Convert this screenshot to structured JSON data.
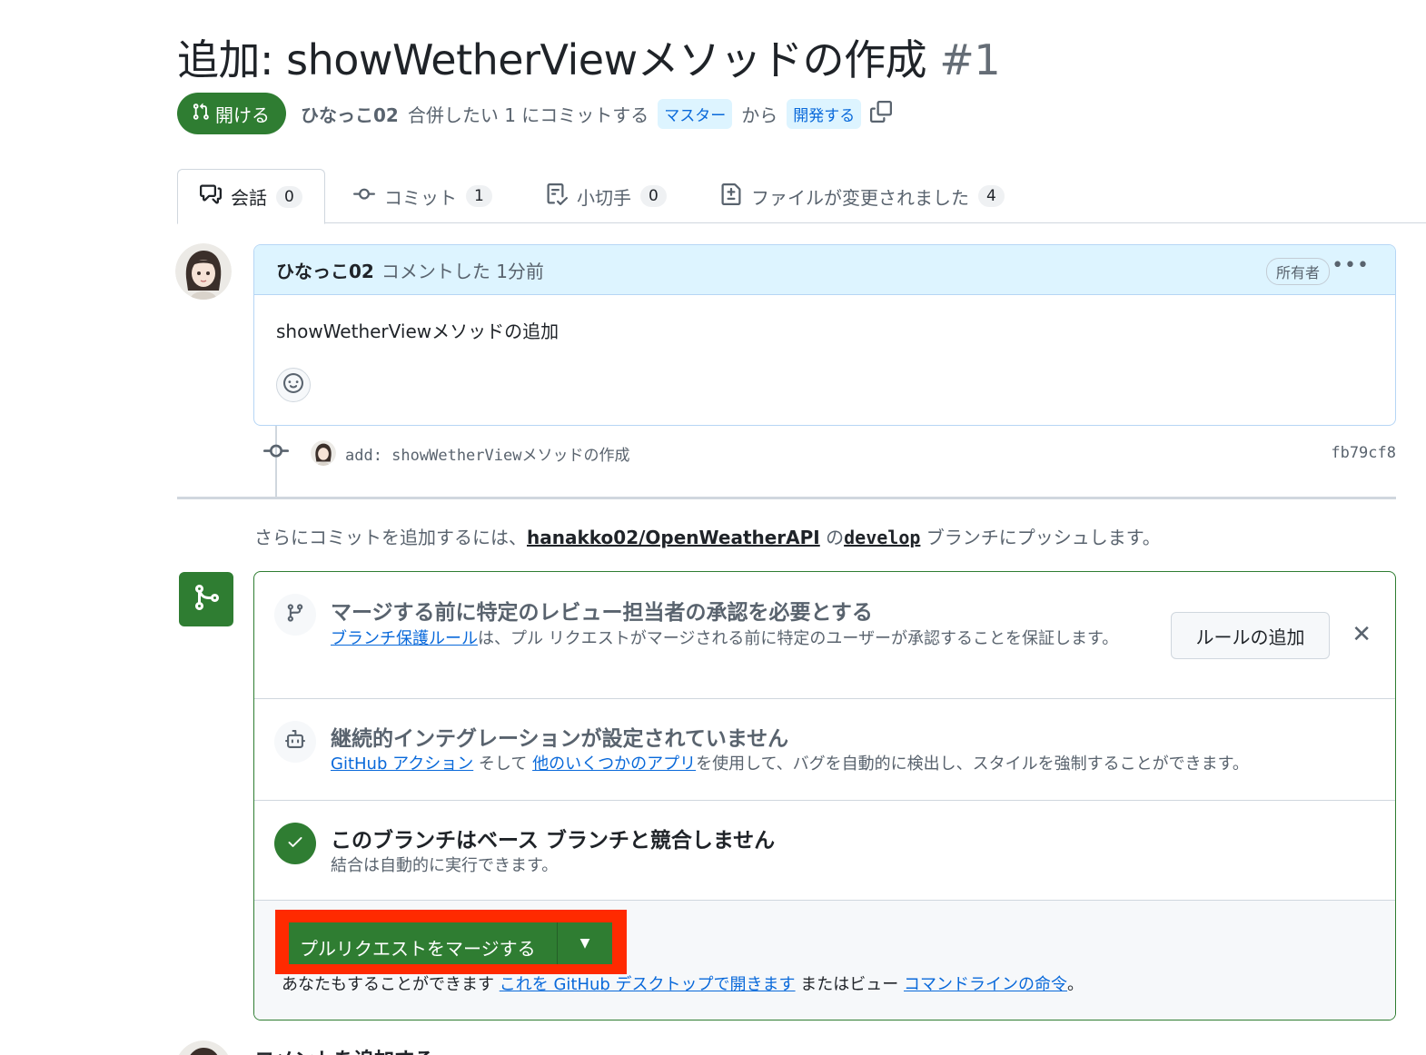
{
  "pr": {
    "title": "追加: showWetherViewメソッドの作成",
    "number": "#1",
    "state_label": "開ける",
    "author": "ひなっこ02",
    "merge_text": "合併したい 1 にコミットする",
    "base_branch": "マスター",
    "from_text": "から",
    "head_branch": "開発する"
  },
  "tabs": [
    {
      "label": "会話",
      "count": "0",
      "icon": "conversation-icon"
    },
    {
      "label": "コミット",
      "count": "1",
      "icon": "commit-icon"
    },
    {
      "label": "小切手",
      "count": "0",
      "icon": "checklist-icon"
    },
    {
      "label": "ファイルが変更されました",
      "count": "4",
      "icon": "file-diff-icon"
    }
  ],
  "comment": {
    "author": "ひなっこ02",
    "meta": "コメントした 1分前",
    "badge": "所有者",
    "body": "showWetherViewメソッドの追加"
  },
  "commit": {
    "message": "add: showWetherViewメソッドの作成",
    "sha": "fb79cf8"
  },
  "push_hint": {
    "prefix": "さらにコミットを追加するには、",
    "repo": "hanakko02/OpenWeatherAPI",
    "mid": " の",
    "branch": "develop",
    "suffix": " ブランチにプッシュします。"
  },
  "merge_box": {
    "review": {
      "title": "マージする前に特定のレビュー担当者の承認を必要とする",
      "link": "ブランチ保護ルール",
      "desc": "は、プル リクエストがマージされる前に特定のユーザーが承認することを保証します。",
      "button": "ルールの追加",
      "close": "✕"
    },
    "ci": {
      "title": "継続的インテグレーションが設定されていません",
      "link1": "GitHub アクション",
      "mid": " そして ",
      "link2": "他のいくつかのアプリ",
      "desc": "を使用して、バグを自動的に検出し、スタイルを強制することができます。"
    },
    "conflict": {
      "title": "このブランチはベース ブランチと競合しません",
      "desc": "結合は自動的に実行できます。"
    },
    "merge_button": "プルリクエストをマージする",
    "alt_prefix": "あなたもすることができます ",
    "alt_link1": "これを GitHub デスクトップで開きます",
    "alt_mid": " またはビュー ",
    "alt_link2": "コマンドラインの命令",
    "alt_suffix": "。"
  },
  "add_comment_heading": "コメントを追加する",
  "colors": {
    "accent_green": "#2f7d32",
    "link_blue": "#0969da",
    "highlight_red": "#ff2a00",
    "comment_header_bg": "#ddf4ff"
  }
}
